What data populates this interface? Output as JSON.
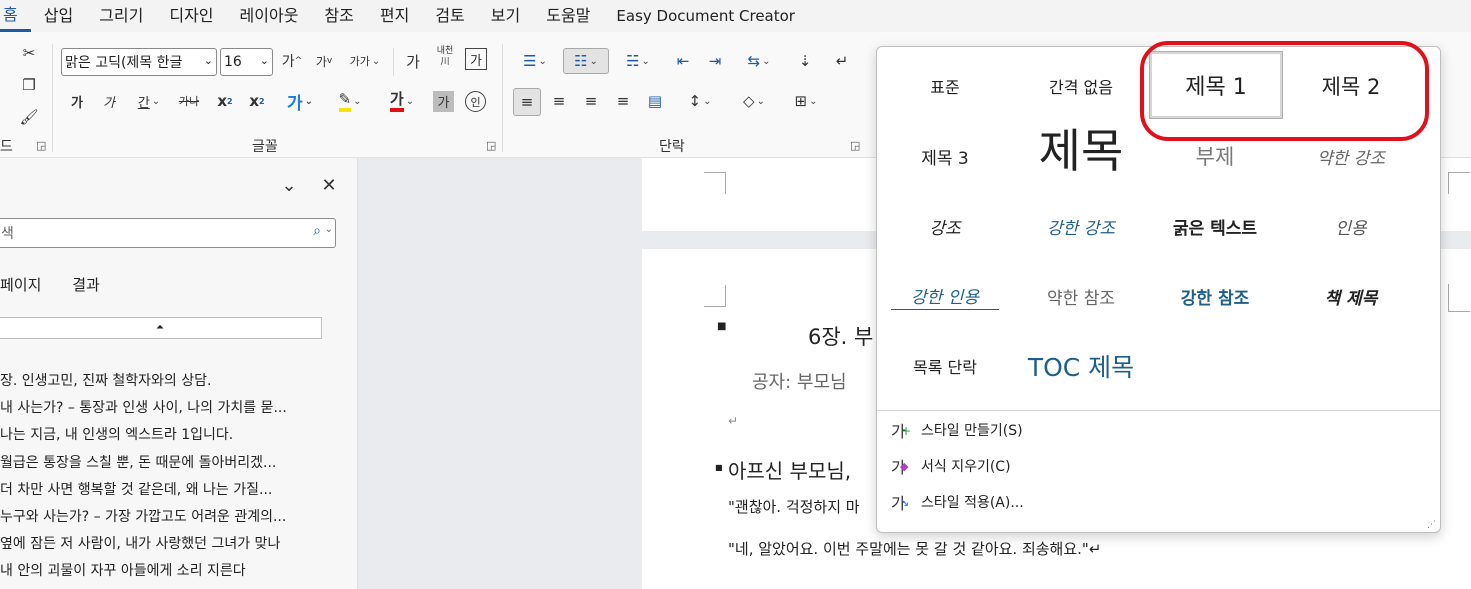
{
  "menubar": {
    "items": [
      "홈",
      "삽입",
      "그리기",
      "디자인",
      "레이아웃",
      "참조",
      "편지",
      "검토",
      "보기",
      "도움말",
      "Easy Document Creator"
    ]
  },
  "ribbon": {
    "clipboard_label": "드",
    "font_group_label": "글꼴",
    "paragraph_group_label": "단락",
    "font_name": "맑은 고딕(제목 한글",
    "font_size": "16",
    "grow_font": "가",
    "shrink_font": "가",
    "hanja": "가가",
    "phonetic": "내천",
    "phonetic_sub": "川",
    "enclose": "가",
    "bold": "가",
    "italic": "가",
    "underline": "간",
    "strike": "가나",
    "sub": "x",
    "sup": "x",
    "text_effect": "가",
    "highlight": "가",
    "font_color": "가",
    "shading": "가",
    "enclosed_char": "인"
  },
  "navpane": {
    "search_placeholder": "색",
    "tabs": [
      "페이지",
      "결과"
    ],
    "headings": [
      "장. 인생고민, 진짜 철학자와의 상담.",
      "내 사는가? – 통장과 인생 사이, 나의 가치를 묻...",
      "나는 지금, 내 인생의 엑스트라 1입니다.",
      "월급은 통장을 스칠 뿐, 돈 때문에 돌아버리겠...",
      "더 차만 사면 행복할 것 같은데, 왜 나는 가질...",
      "누구와 사는가? – 가장 가깝고도 어려운 관계의...",
      "옆에 잠든 저 사람이, 내가 사랑했던 그녀가 맞나",
      "내 안의 괴물이 자꾸 아들에게 소리 지른다"
    ]
  },
  "document": {
    "chapter_title": "6장. 부",
    "subtitle": "공자: 부모님",
    "para_mark": "↵",
    "heading2": "아프신 부모님,",
    "quote1": "\"괜찮아. 걱정하지 마",
    "quote2": "\"네, 알았어요. 이번 주말에는 못 갈 것 같아요. 죄송해요.\"↵"
  },
  "gallery": {
    "styles": [
      {
        "label": "표준"
      },
      {
        "label": "간격 없음"
      },
      {
        "label": "제목 1"
      },
      {
        "label": "제목 2"
      },
      {
        "label": "제목 3"
      },
      {
        "label": "제목"
      },
      {
        "label": "부제"
      },
      {
        "label": "약한 강조"
      },
      {
        "label": "강조"
      },
      {
        "label": "강한 강조"
      },
      {
        "label": "굵은 텍스트"
      },
      {
        "label": "인용"
      },
      {
        "label": "강한 인용"
      },
      {
        "label": "약한 참조"
      },
      {
        "label": "강한 참조"
      },
      {
        "label": "책 제목"
      },
      {
        "label": "목록 단락"
      },
      {
        "label": "TOC 제목"
      }
    ],
    "actions": [
      {
        "label": "스타일 만들기(S)"
      },
      {
        "label": "서식 지우기(C)"
      },
      {
        "label": "스타일 적용(A)..."
      }
    ],
    "highlight_color": "#e2101a",
    "accent_color": "#1f5f8b"
  }
}
